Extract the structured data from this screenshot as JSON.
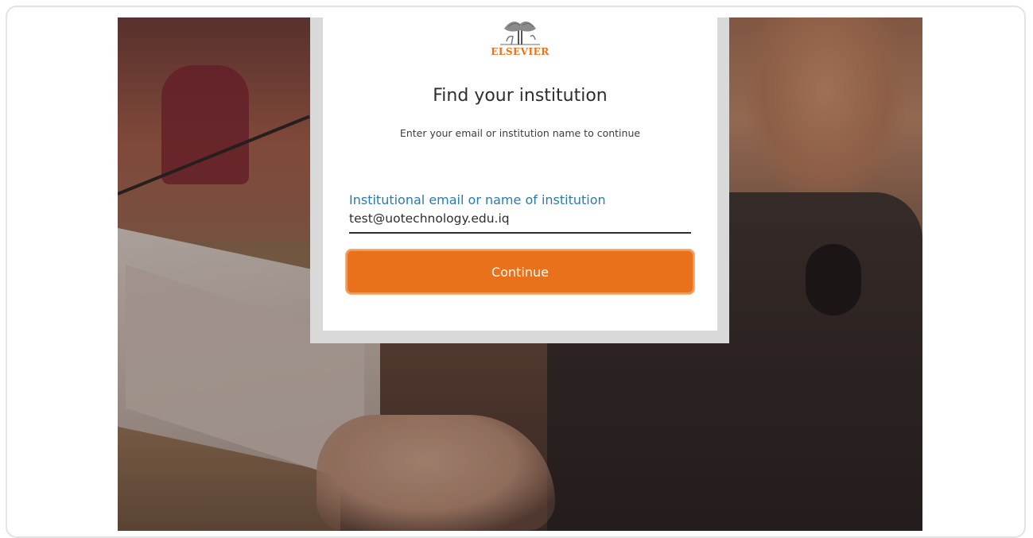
{
  "brand": {
    "logo_text": "ELSEVIER",
    "logo_icon": "elsevier-tree-icon",
    "accent_color": "#e9711c"
  },
  "dialog": {
    "title": "Find your institution",
    "subtitle": "Enter your email or institution name to continue",
    "field": {
      "label": "Institutional email or name of institution",
      "value": "test@uotechnology.edu.iq"
    },
    "continue_label": "Continue"
  },
  "colors": {
    "label": "#2a7bad",
    "button": "#e9711c",
    "text": "#2e2e2e"
  }
}
